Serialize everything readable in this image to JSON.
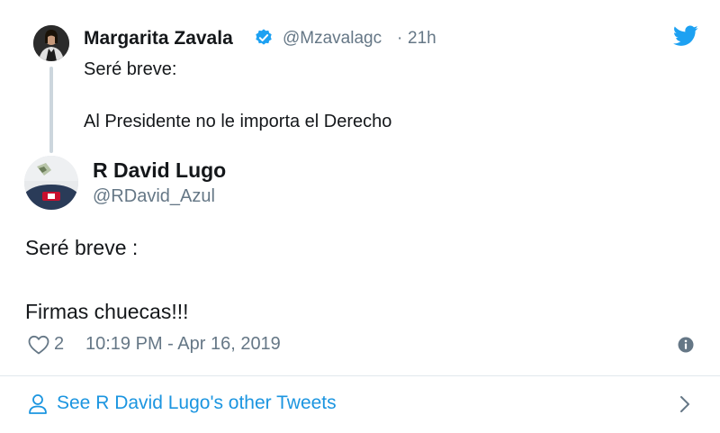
{
  "parent_tweet": {
    "author_name": "Margarita Zavala",
    "handle": "@Mzavalagc",
    "separator": "·",
    "relative_time": "21h",
    "text_line1": "Seré breve:",
    "text_line2": "Al Presidente no le importa el Derecho",
    "verified": true
  },
  "main_tweet": {
    "author_name": "R David Lugo",
    "handle": "@RDavid_Azul",
    "text_line1": "Seré breve :",
    "text_line2": "Firmas chuecas!!!",
    "likes": "2",
    "timestamp": "10:19 PM - Apr 16, 2019"
  },
  "footer": {
    "link_text": "See R David Lugo's other Tweets"
  },
  "icons": {
    "brand": "twitter-bird-icon",
    "like": "heart-icon",
    "info": "info-icon",
    "profile": "person-icon",
    "chevron": "chevron-right-icon",
    "verified": "verified-badge-icon"
  },
  "colors": {
    "accent": "#1da1f2",
    "link": "#1b95e0",
    "text": "#14171a",
    "muted": "#657786",
    "divider": "#e1e8ed"
  }
}
